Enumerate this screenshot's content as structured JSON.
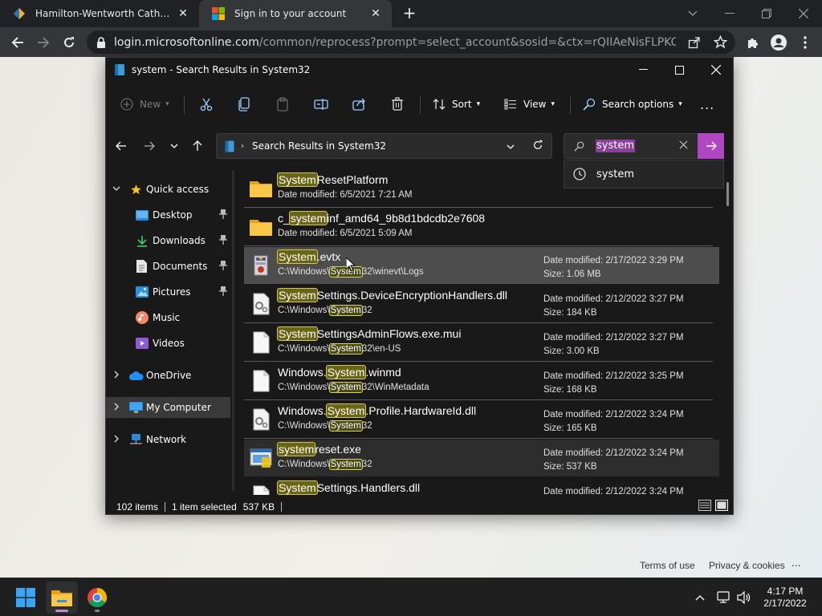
{
  "browser": {
    "tabs": [
      {
        "title": "Hamilton-Wentworth Catholic D",
        "active": false
      },
      {
        "title": "Sign in to your account",
        "active": true
      }
    ],
    "url_host": "login.microsoftonline.com",
    "url_path": "/common/reprocess?prompt=select_account&sosid=&ctx=rQIIAeNisFLPKCkpKLbS188..."
  },
  "page": {
    "footer_terms": "Terms of use",
    "footer_privacy": "Privacy & cookies",
    "footer_more": "..."
  },
  "explorer": {
    "title": "system - Search Results in System32",
    "commands": {
      "new": "New",
      "sort": "Sort",
      "view": "View",
      "search_options": "Search options",
      "more": "..."
    },
    "address": "Search Results in System32",
    "search_value": "system",
    "suggestion": "system",
    "nav": {
      "quick_access": "Quick access",
      "desktop": "Desktop",
      "downloads": "Downloads",
      "documents": "Documents",
      "pictures": "Pictures",
      "music": "Music",
      "videos": "Videos",
      "onedrive": "OneDrive",
      "my_computer": "My Computer",
      "network": "Network"
    },
    "rows": [
      {
        "pre": "",
        "hl": "System",
        "post": "ResetPlatform",
        "sub_pre": "Date modified: 6/5/2021 7:21 AM",
        "sub_hl": "",
        "sub_post": "",
        "meta1": "",
        "meta2": "",
        "icon": "folder"
      },
      {
        "pre": "c_",
        "hl": "system",
        "post": "inf_amd64_9b8d1bdcdb2e7608",
        "sub_pre": "Date modified: 6/5/2021 5:09 AM",
        "sub_hl": "",
        "sub_post": "",
        "meta1": "",
        "meta2": "",
        "icon": "folder"
      },
      {
        "pre": "",
        "hl": "System",
        "post": ".evtx",
        "sub_pre": "C:\\Windows\\",
        "sub_hl": "System",
        "sub_post": "32\\winevt\\Logs",
        "meta1": "Date modified: 2/17/2022 3:29 PM",
        "meta2": "Size: 1.06 MB",
        "icon": "evtx"
      },
      {
        "pre": "",
        "hl": "System",
        "post": "Settings.DeviceEncryptionHandlers.dll",
        "sub_pre": "C:\\Windows\\",
        "sub_hl": "System",
        "sub_post": "32",
        "meta1": "Date modified: 2/12/2022 3:27 PM",
        "meta2": "Size: 184 KB",
        "icon": "dll"
      },
      {
        "pre": "",
        "hl": "System",
        "post": "SettingsAdminFlows.exe.mui",
        "sub_pre": "C:\\Windows\\",
        "sub_hl": "System",
        "sub_post": "32\\en-US",
        "meta1": "Date modified: 2/12/2022 3:27 PM",
        "meta2": "Size: 3.00 KB",
        "icon": "file"
      },
      {
        "pre": "Windows.",
        "hl": "System",
        "post": ".winmd",
        "sub_pre": "C:\\Windows\\",
        "sub_hl": "System",
        "sub_post": "32\\WinMetadata",
        "meta1": "Date modified: 2/12/2022 3:25 PM",
        "meta2": "Size: 168 KB",
        "icon": "file"
      },
      {
        "pre": "Windows.",
        "hl": "System",
        "post": ".Profile.HardwareId.dll",
        "sub_pre": "C:\\Windows\\",
        "sub_hl": "System",
        "sub_post": "32",
        "meta1": "Date modified: 2/12/2022 3:24 PM",
        "meta2": "Size: 165 KB",
        "icon": "dll"
      },
      {
        "pre": "",
        "hl": "system",
        "post": "reset.exe",
        "sub_pre": "C:\\Windows\\",
        "sub_hl": "System",
        "sub_post": "32",
        "meta1": "Date modified: 2/12/2022 3:24 PM",
        "meta2": "Size: 537 KB",
        "icon": "exe"
      },
      {
        "pre": "",
        "hl": "System",
        "post": "Settings.Handlers.dll",
        "sub_pre": "",
        "sub_hl": "",
        "sub_post": "",
        "meta1": "Date modified: 2/12/2022 3:24 PM",
        "meta2": "",
        "icon": "file"
      }
    ],
    "status": {
      "items": "102 items",
      "selected": "1 item selected",
      "size": "537 KB"
    }
  },
  "taskbar": {
    "time": "4:17 PM",
    "date": "2/17/2022"
  },
  "colors": {
    "accent": "#b146c2",
    "highlight": "#d9d26d",
    "explorer_bg": "#191919"
  }
}
